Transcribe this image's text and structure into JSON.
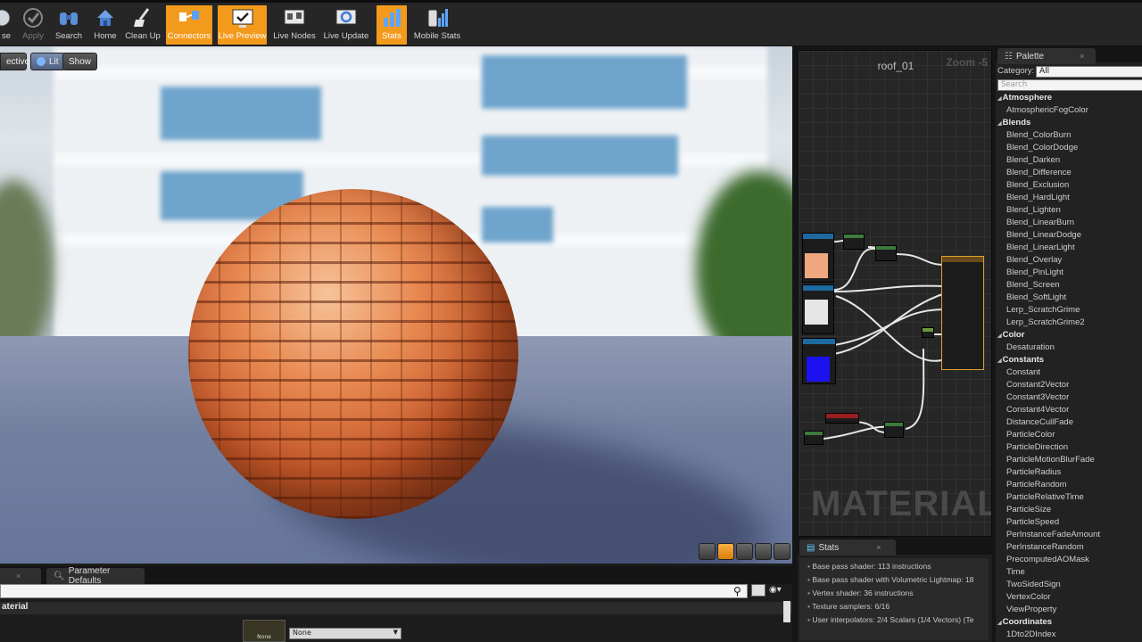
{
  "toolbar": {
    "buttons": [
      {
        "label": "se",
        "icon": "browse-icon"
      },
      {
        "label": "Apply",
        "icon": "check-icon"
      },
      {
        "label": "Search",
        "icon": "search-binoculars-icon"
      },
      {
        "label": "Home",
        "icon": "home-icon"
      },
      {
        "label": "Clean Up",
        "icon": "broom-icon"
      },
      {
        "label": "Connectors",
        "icon": "connectors-icon"
      },
      {
        "label": "Live Preview",
        "icon": "live-preview-icon"
      },
      {
        "label": "Live Nodes",
        "icon": "live-nodes-icon"
      },
      {
        "label": "Live Update",
        "icon": "live-update-icon"
      },
      {
        "label": "Stats",
        "icon": "stats-icon"
      },
      {
        "label": "Mobile Stats",
        "icon": "mobile-stats-icon"
      }
    ],
    "accent": "#f39a1c"
  },
  "viewport": {
    "perspective_label": "ective",
    "lit_label": "Lit",
    "show_label": "Show"
  },
  "details": {
    "tab_label": "Parameter Defaults",
    "section_label": "aterial",
    "texture_thumb_label": "None",
    "dropdown_value": "None"
  },
  "graph": {
    "title": "roof_01",
    "zoom": "Zoom -5",
    "watermark": "MATERIAL"
  },
  "stats": {
    "tab_label": "Stats",
    "lines": [
      "Base pass shader: 113 instructions",
      "Base pass shader with Volumetric Lightmap: 18",
      "Vertex shader: 36 instructions",
      "Texture samplers: 6/16",
      "User interpolators: 2/4 Scalars (1/4 Vectors) (Te"
    ]
  },
  "palette": {
    "tab_label": "Palette",
    "category_label": "Category:",
    "category_value": "All",
    "search_placeholder": "Search",
    "groups": [
      {
        "name": "Atmosphere",
        "items": [
          "AtmosphericFogColor"
        ]
      },
      {
        "name": "Blends",
        "items": [
          "Blend_ColorBurn",
          "Blend_ColorDodge",
          "Blend_Darken",
          "Blend_Difference",
          "Blend_Exclusion",
          "Blend_HardLight",
          "Blend_Lighten",
          "Blend_LinearBurn",
          "Blend_LinearDodge",
          "Blend_LinearLight",
          "Blend_Overlay",
          "Blend_PinLight",
          "Blend_Screen",
          "Blend_SoftLight",
          "Lerp_ScratchGrime",
          "Lerp_ScratchGrime2"
        ]
      },
      {
        "name": "Color",
        "items": [
          "Desaturation"
        ]
      },
      {
        "name": "Constants",
        "items": [
          "Constant",
          "Constant2Vector",
          "Constant3Vector",
          "Constant4Vector",
          "DistanceCullFade",
          "ParticleColor",
          "ParticleDirection",
          "ParticleMotionBlurFade",
          "ParticleRadius",
          "ParticleRandom",
          "ParticleRelativeTime",
          "ParticleSize",
          "ParticleSpeed",
          "PerInstanceFadeAmount",
          "PerInstanceRandom",
          "PrecomputedAOMask",
          "Time",
          "TwoSidedSign",
          "VertexColor",
          "ViewProperty"
        ]
      },
      {
        "name": "Coordinates",
        "items": [
          "1Dto2DIndex"
        ]
      }
    ]
  }
}
